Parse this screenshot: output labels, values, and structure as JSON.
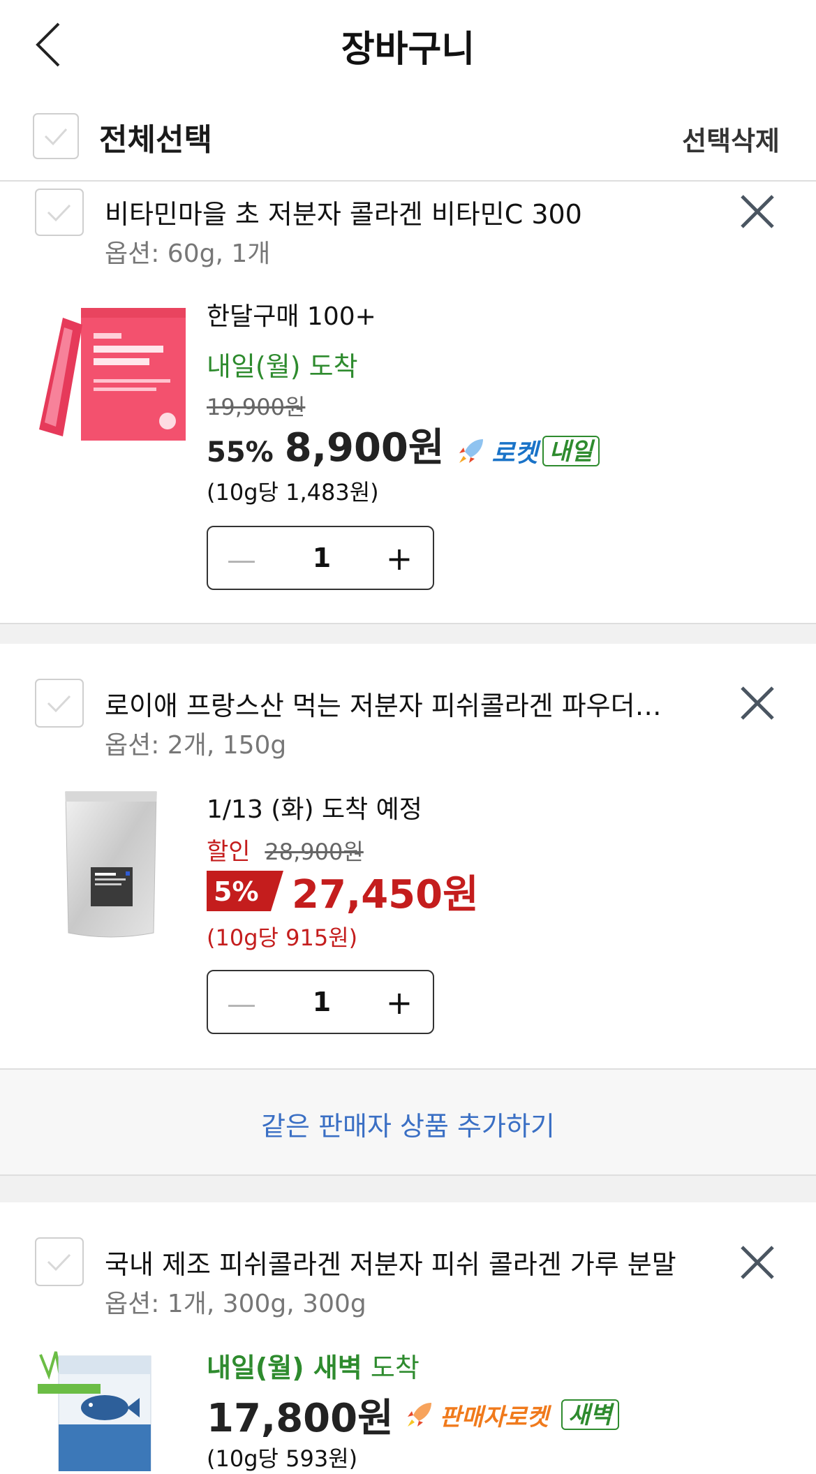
{
  "header": {
    "title": "장바구니",
    "select_all_label": "전체선택",
    "delete_selected_label": "선택삭제"
  },
  "colors": {
    "rocket_blue": "#1a73c8",
    "delivery_green": "#2e8b2e",
    "sale_red": "#c41d1d",
    "seller_rocket_orange": "#f07a1c",
    "link_blue": "#3a6fc4"
  },
  "items": [
    {
      "name": "비타민마을 초 저분자 콜라겐 비타민C 300",
      "option": "옵션: 60g, 1개",
      "promo": "한달구매 100+",
      "delivery": "내일(월) 도착",
      "original_price": "19,900원",
      "discount": "55%",
      "price": "8,900원",
      "badge_name": "로켓",
      "badge_tag": "내일",
      "unit_price": "(10g당 1,483원)",
      "quantity": "1",
      "image_icon": "pink-collagen-box-image"
    },
    {
      "name": "로이애 프랑스산 먹는 저분자 피쉬콜라겐 파우더…",
      "option": "옵션: 2개, 150g",
      "delivery": "1/13 (화) 도착 예정",
      "sale_label": "할인",
      "original_price": "28,900원",
      "discount": "5%",
      "price": "27,450원",
      "unit_price": "(10g당 915원)",
      "quantity": "1",
      "image_icon": "silver-pouch-image"
    },
    {
      "name": "국내 제조 피쉬콜라겐 저분자 피쉬 콜라겐 가루 분말",
      "option": "옵션: 1개, 300g, 300g",
      "delivery_day": "내일(월) 새벽",
      "delivery_suffix": "도착",
      "price": "17,800원",
      "badge_name": "판매자로켓",
      "badge_tag": "새벽",
      "unit_price": "(10g당 593원)",
      "image_icon": "blue-fish-pouch-image"
    }
  ],
  "add_same_seller_label": "같은 판매자 상품 추가하기"
}
